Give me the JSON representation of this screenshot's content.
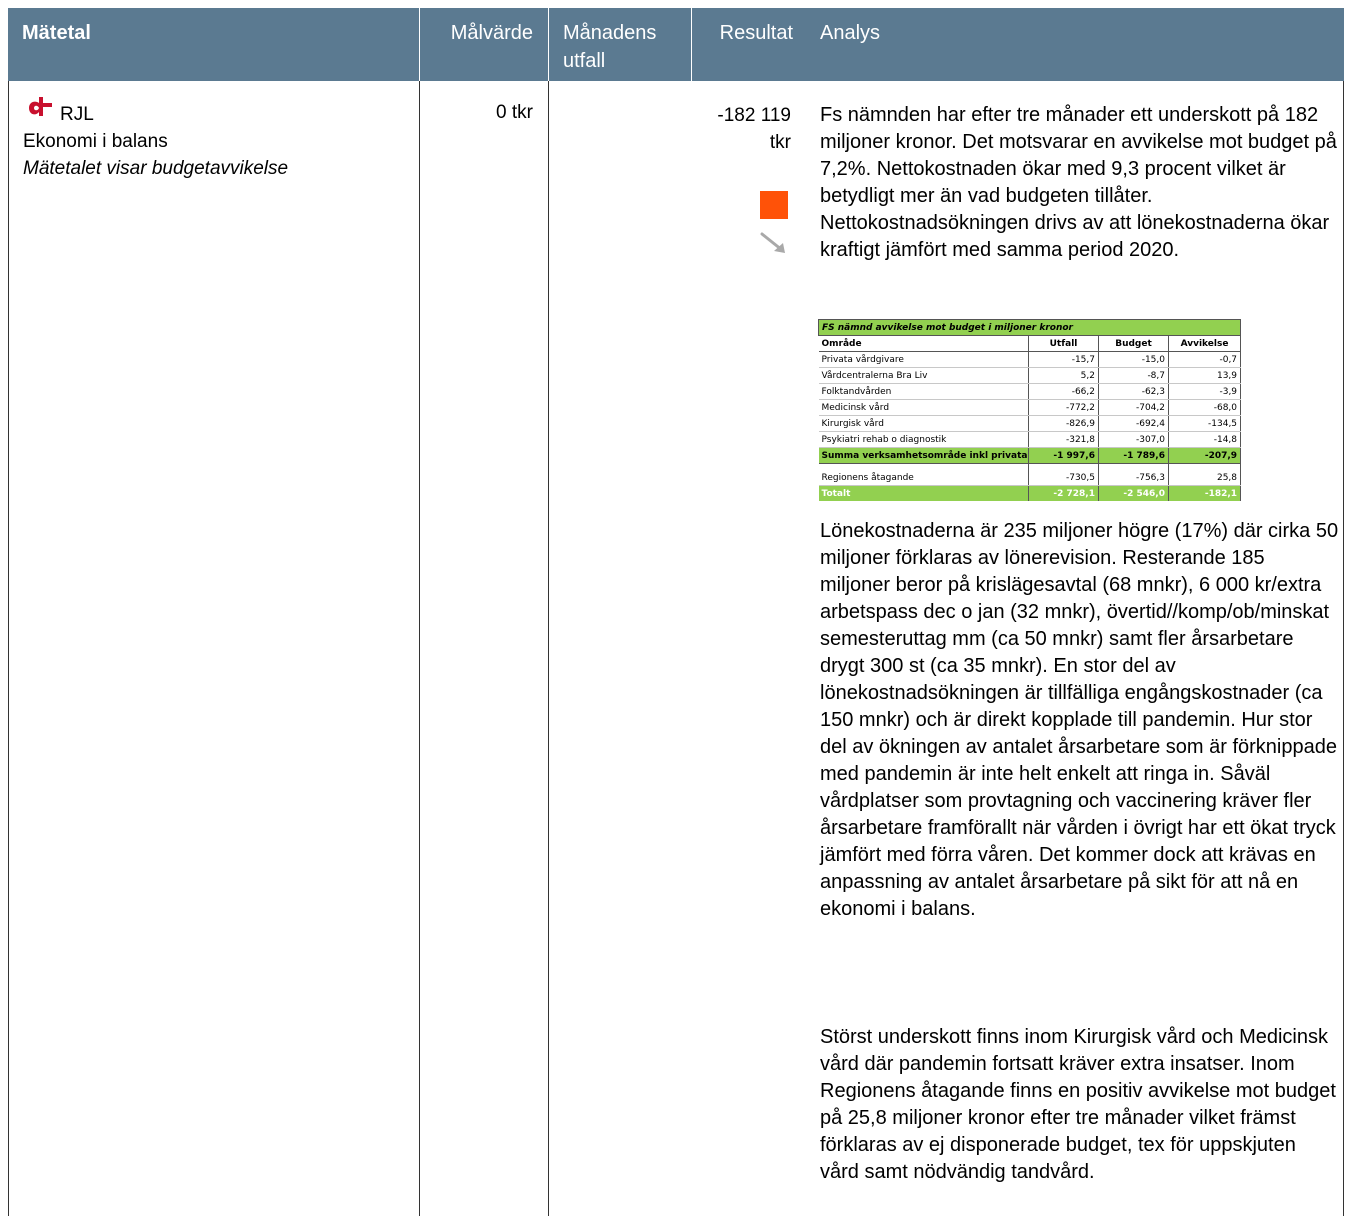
{
  "header": {
    "metric": "Mätetal",
    "target": "Målvärde",
    "monthly_outcome": "Månadens utfall",
    "result": "Resultat",
    "analysis": "Analys"
  },
  "row": {
    "organization": "RJL",
    "metric_name": "Ekonomi i balans",
    "metric_description": "Mätetalet visar budgetavvikelse",
    "target_value": "0 tkr",
    "monthly_outcome": "",
    "result_value": "-182 119 tkr",
    "status_color": "#ff5208",
    "trend": "arrow-down-right",
    "analysis": {
      "paragraph_1": "Fs nämnden har efter tre månader ett underskott på 182 miljoner kronor. Det motsvarar en avvikelse mot budget på 7,2%. Nettokostnaden ökar med 9,3 procent vilket är betydligt mer än vad budgeten tillåter. Nettokostnadsökningen drivs av att lönekostnaderna ökar kraftigt jämfört med samma period 2020.",
      "paragraph_2": "Lönekostnaderna är 235 miljoner högre (17%) där cirka 50 miljoner förklaras av lönerevision. Resterande 185 miljoner beror på krislägesavtal (68 mnkr), 6 000 kr/extra arbetspass dec o jan (32 mnkr), övertid//komp/ob/minskat semesteruttag mm  (ca 50 mnkr) samt fler årsarbetare drygt 300 st (ca 35 mnkr). En stor del av lönekostnadsökningen är tillfälliga engångskostnader (ca 150 mnkr) och är direkt kopplade till pandemin. Hur stor del av ökningen av antalet årsarbetare som är förknippade med pandemin är inte helt enkelt att ringa in. Såväl vårdplatser som provtagning och vaccinering kräver fler årsarbetare framförallt när vården i övrigt har ett ökat tryck jämfört med förra våren. Det kommer dock att krävas en anpassning av antalet årsarbetare på sikt för att nå en ekonomi i balans.",
      "paragraph_3": "Störst underskott finns inom Kirurgisk vård och Medicinsk vård där pandemin fortsatt kräver extra insatser. Inom Regionens åtagande finns en positiv avvikelse mot budget på 25,8 miljoner kronor efter tre månader vilket främst förklaras av ej disponerade budget, tex för uppskjuten vård samt nödvändig tandvård."
    },
    "budget_table": {
      "title": "FS nämnd avvikelse mot budget i miljoner kronor",
      "columns": [
        "Område",
        "Utfall",
        "Budget",
        "Avvikelse"
      ],
      "rows": [
        [
          "Privata vårdgivare",
          "-15,7",
          "-15,0",
          "-0,7"
        ],
        [
          "Vårdcentralerna Bra Liv",
          "5,2",
          "-8,7",
          "13,9"
        ],
        [
          "Folktandvården",
          "-66,2",
          "-62,3",
          "-3,9"
        ],
        [
          "Medicinsk vård",
          "-772,2",
          "-704,2",
          "-68,0"
        ],
        [
          "Kirurgisk vård",
          "-826,9",
          "-692,4",
          "-134,5"
        ],
        [
          "Psykiatri rehab o diagnostik",
          "-321,8",
          "-307,0",
          "-14,8"
        ]
      ],
      "subtotal": [
        "Summa verksamhetsområde inkl privata",
        "-1 997,6",
        "-1 789,6",
        "-207,9"
      ],
      "extra_row": [
        "Regionens åtagande",
        "-730,5",
        "-756,3",
        "25,8"
      ],
      "total": [
        "Totalt",
        "-2 728,1",
        "-2 546,0",
        "-182,1"
      ],
      "highlight_color": "#92d050"
    }
  }
}
